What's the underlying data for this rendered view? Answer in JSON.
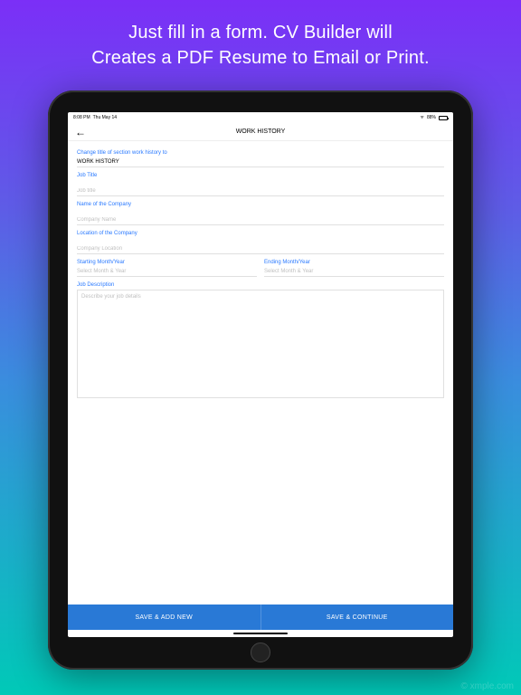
{
  "promo": {
    "line1": "Just fill in a form. CV Builder will",
    "line2": "Creates a PDF Resume to Email or Print."
  },
  "statusBar": {
    "time": "8:08 PM",
    "date": "Thu May 14",
    "battery": "88%"
  },
  "nav": {
    "title": "WORK HISTORY"
  },
  "form": {
    "sectionTitleLabel": "Change title of section work history to",
    "sectionTitleValue": "WORK HISTORY",
    "jobTitleLabel": "Job Title",
    "jobTitlePlaceholder": "Job title",
    "companyNameLabel": "Name of the Company",
    "companyNamePlaceholder": "Company Name",
    "locationLabel": "Location of the Company",
    "locationPlaceholder": "Company Location",
    "startDateLabel": "Starting Month/Year",
    "startDatePlaceholder": "Select Month & Year",
    "endDateLabel": "Ending Month/Year",
    "endDatePlaceholder": "Select Month & Year",
    "descriptionLabel": "Job Description",
    "descriptionPlaceholder": "Describe your job details"
  },
  "buttons": {
    "saveAddNew": "SAVE & ADD NEW",
    "saveContinue": "SAVE & CONTINUE"
  },
  "watermark": "© xmple.com"
}
